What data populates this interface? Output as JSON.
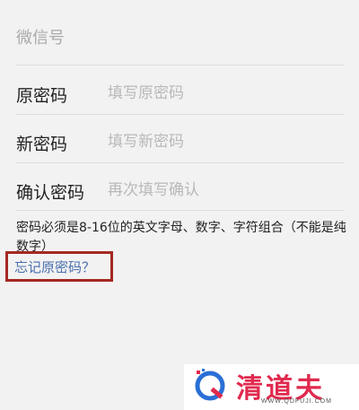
{
  "wechat_id_label": "微信号",
  "fields": [
    {
      "label": "原密码",
      "placeholder": "填写原密码"
    },
    {
      "label": "新密码",
      "placeholder": "填写新密码"
    },
    {
      "label": "确认密码",
      "placeholder": "再次填写确认"
    }
  ],
  "hint": "密码必须是8-16位的英文字母、数字、字符组合（不能是纯数字）",
  "forgot_link": "忘记原密码？",
  "watermark": {
    "brand": "清道夫",
    "url": "WWW.QDFUJI.COM",
    "color": "#e02a4e"
  },
  "colors": {
    "background": "#f2f2f2",
    "link": "#4b6fae",
    "highlight_box": "#a52822"
  }
}
